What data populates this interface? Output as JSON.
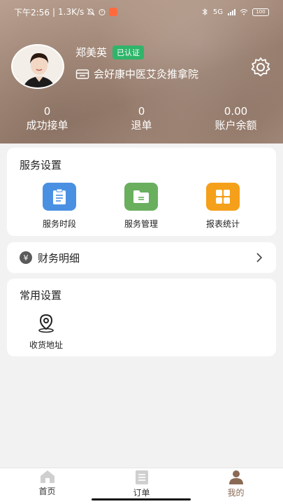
{
  "status_bar": {
    "time": "下午2:56",
    "speed": "1.3K/s",
    "signal": "5G",
    "battery": "100"
  },
  "profile": {
    "name": "郑美英",
    "badge": "已认证",
    "shop": "会好康中医艾灸推拿院"
  },
  "stats": [
    {
      "value": "0",
      "label": "成功接单"
    },
    {
      "value": "0",
      "label": "退单"
    },
    {
      "value": "0.00",
      "label": "账户余额"
    }
  ],
  "services": {
    "title": "服务设置",
    "items": [
      {
        "label": "服务时段",
        "color": "#4a90e2",
        "icon": "clipboard-icon"
      },
      {
        "label": "服务管理",
        "color": "#6aaf5e",
        "icon": "folder-icon"
      },
      {
        "label": "报表统计",
        "color": "#f5a01a",
        "icon": "grid-icon"
      }
    ]
  },
  "finance": {
    "label": "财务明细",
    "icon": "yen-icon"
  },
  "common": {
    "title": "常用设置",
    "items": [
      {
        "label": "收货地址",
        "icon": "location-pin-icon"
      }
    ]
  },
  "tabbar": {
    "items": [
      {
        "label": "首页",
        "icon": "home-icon",
        "active": false
      },
      {
        "label": "订单",
        "icon": "orders-icon",
        "active": false
      },
      {
        "label": "我的",
        "icon": "user-icon",
        "active": true
      }
    ],
    "active_color": "#8b6a55"
  }
}
